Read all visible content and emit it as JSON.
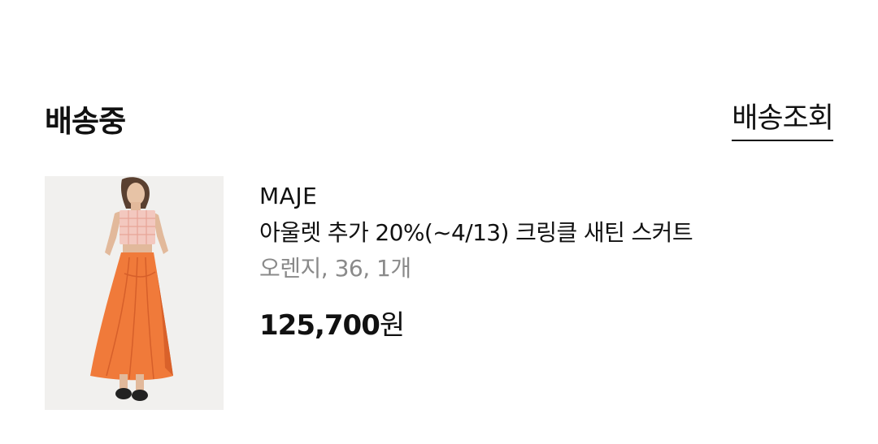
{
  "order": {
    "status": "배송중",
    "track_button": "배송조회"
  },
  "product": {
    "image_icon": "product-photo-orange-skirt",
    "brand": "MAJE",
    "name": "아울렛 추가 20%(~4/13) 크링클 새틴 스커트",
    "options": "오렌지, 36, 1개",
    "price": "125,700",
    "currency": "원"
  },
  "colors": {
    "skirt": "#f07a3a",
    "top": "#f3c8bf",
    "text": "#111111",
    "muted": "#8a8a8a"
  }
}
